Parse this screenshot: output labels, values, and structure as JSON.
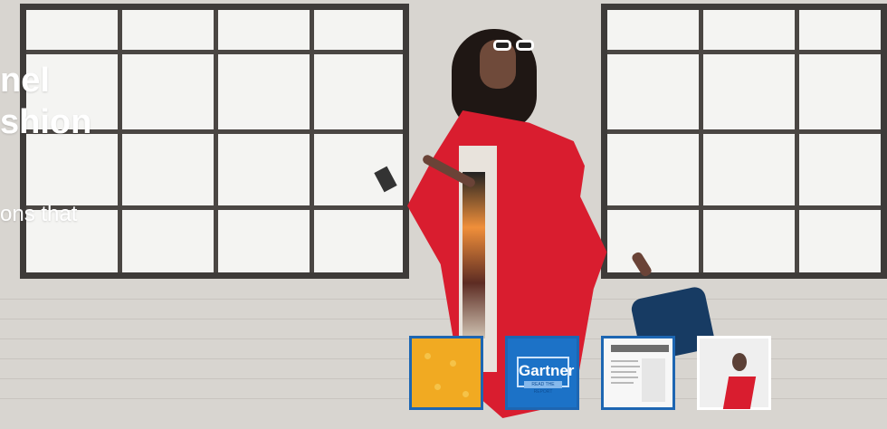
{
  "hero": {
    "headline_line_1": "nel",
    "headline_line_2": "shion",
    "subtext": "ons that"
  },
  "thumbnails": [
    {
      "label": "",
      "active": false
    },
    {
      "label": "Gartner",
      "subtext": "READ THE REPORT",
      "active": false
    },
    {
      "label": "",
      "active": false
    },
    {
      "label": "",
      "active": true
    }
  ],
  "colors": {
    "accent_blue": "#1d66b2",
    "coat_red": "#d91d2f",
    "headline_white": "#ffffff"
  },
  "icons": {
    "gartner_logo": "gartner-logo-icon",
    "document_preview": "document-preview-icon",
    "pattern_preview": "pattern-preview-icon",
    "person_preview": "person-preview-icon"
  }
}
